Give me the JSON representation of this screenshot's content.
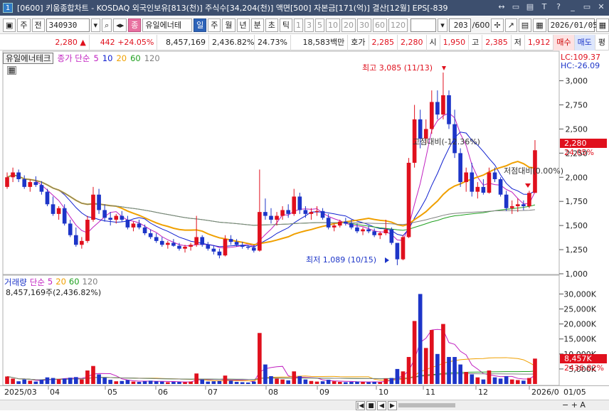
{
  "window": {
    "app_icon": "1",
    "title": "[0600] 키움종합차트 - KOSDAQ 외국인보유[813(천)] 주식수[34,204(천)] 액면[500] 자본금[171(억)] 결산[12월] EPS[-839",
    "buttons": [
      "↔",
      "▭",
      "▤",
      "T",
      "?",
      "_",
      "▭",
      "✕"
    ]
  },
  "toolbar": {
    "market": "주",
    "prev": "전",
    "code": "340930",
    "stock_name": "유일에너테",
    "period_selected": "일",
    "periods": [
      "일",
      "주",
      "월",
      "년",
      "분",
      "초",
      "틱"
    ],
    "intervals": [
      "1",
      "3",
      "5",
      "10",
      "20",
      "30",
      "60",
      "120"
    ],
    "count": "203",
    "count_max": "/600",
    "date": "2026/01/05"
  },
  "quote": {
    "price": "2,280",
    "arrow": "▲",
    "change": "442",
    "change_pct": "+24.05%",
    "volume": "8,457,169",
    "volume_ratio": "2,436.82%",
    "turnover": "24.73%",
    "amount": "18,583백만",
    "hoga_label": "호가",
    "hoga_ask": "2,285",
    "hoga_bid": "2,280",
    "open_label": "시",
    "open": "1,950",
    "high_label": "고",
    "high": "2,385",
    "low_label": "저",
    "low": "1,912",
    "buy": "매수",
    "sell": "매도",
    "eval": "평"
  },
  "price_legend": {
    "stock": "유일에너테크",
    "ma_label": "종가 단순",
    "ma": [
      "5",
      "10",
      "20",
      "60",
      "120"
    ],
    "ma_colors": [
      "#c020c0",
      "#1020d0",
      "#f0a000",
      "#20a020",
      "#808080"
    ],
    "lc": "LC:109.37",
    "hc": "HC:-26.09"
  },
  "volume_legend": {
    "label": "거래량",
    "ma_label": "단순",
    "ma": [
      "5",
      "20",
      "60",
      "120"
    ],
    "value": "8,457,169주(2,436.82%)"
  },
  "annotations": {
    "high": "최고 3,085 (11/13)",
    "low": "최저 1,089 (10/15)",
    "a1": "-26.09%",
    "a1_prefix": "고점대비(-12.36%)",
    "a2": "저점대비(0.00%)"
  },
  "price_axis": [
    "3,000",
    "2,750",
    "2,500",
    "2,250",
    "2,000",
    "1,750",
    "1,500",
    "1,250",
    "1,000"
  ],
  "volume_axis": [
    "30,000K",
    "25,000K",
    "20,000K",
    "15,000K",
    "10,000K",
    "5,000K"
  ],
  "price_tags": {
    "close": "2,280",
    "pct": "24.05%",
    "vol": "8,457K",
    "vol_pct": "2436.82%"
  },
  "x_labels": [
    "2025/03",
    "04",
    "05",
    "06",
    "07",
    "08",
    "09",
    "10",
    "11",
    "12",
    "2026/0",
    "01/05"
  ],
  "chart_data": {
    "type": "candlestick",
    "ylim": [
      1000,
      3100
    ],
    "vol_ylim": [
      0,
      32000
    ],
    "daily": [
      [
        1900,
        2050,
        1880,
        2000,
        2500
      ],
      [
        2000,
        2100,
        1950,
        2050,
        1800
      ],
      [
        2050,
        2080,
        1950,
        1980,
        900
      ],
      [
        1980,
        2020,
        1880,
        1900,
        1500
      ],
      [
        1900,
        1980,
        1850,
        1950,
        1100
      ],
      [
        1950,
        2010,
        1900,
        1920,
        800
      ],
      [
        1920,
        1960,
        1820,
        1850,
        1400
      ],
      [
        1850,
        1880,
        1700,
        1720,
        2200
      ],
      [
        1720,
        1800,
        1600,
        1620,
        2000
      ],
      [
        1620,
        1700,
        1560,
        1680,
        1600
      ],
      [
        1680,
        1720,
        1500,
        1520,
        1800
      ],
      [
        1520,
        1560,
        1380,
        1400,
        2100
      ],
      [
        1400,
        1480,
        1280,
        1300,
        2300
      ],
      [
        1300,
        1380,
        1260,
        1340,
        1500
      ],
      [
        1340,
        1600,
        1320,
        1560,
        4500
      ],
      [
        1560,
        1900,
        1540,
        1820,
        6000
      ],
      [
        1820,
        1880,
        1620,
        1660,
        3200
      ],
      [
        1660,
        1720,
        1540,
        1580,
        2100
      ],
      [
        1580,
        1640,
        1500,
        1560,
        1400
      ],
      [
        1560,
        1620,
        1520,
        1600,
        900
      ],
      [
        1600,
        1650,
        1540,
        1560,
        1000
      ],
      [
        1560,
        1600,
        1460,
        1480,
        1300
      ],
      [
        1480,
        1540,
        1440,
        1520,
        800
      ],
      [
        1520,
        1560,
        1460,
        1480,
        700
      ],
      [
        1480,
        1510,
        1400,
        1420,
        900
      ],
      [
        1420,
        1460,
        1360,
        1380,
        1100
      ],
      [
        1380,
        1420,
        1320,
        1340,
        900
      ],
      [
        1340,
        1380,
        1280,
        1300,
        800
      ],
      [
        1300,
        1340,
        1260,
        1320,
        600
      ],
      [
        1320,
        1360,
        1280,
        1290,
        700
      ],
      [
        1290,
        1320,
        1240,
        1260,
        700
      ],
      [
        1260,
        1300,
        1220,
        1280,
        600
      ],
      [
        1280,
        1320,
        1240,
        1300,
        800
      ],
      [
        1300,
        1600,
        1280,
        1380,
        3500
      ],
      [
        1380,
        1400,
        1280,
        1300,
        1500
      ],
      [
        1300,
        1330,
        1240,
        1260,
        800
      ],
      [
        1260,
        1290,
        1200,
        1230,
        900
      ],
      [
        1230,
        1260,
        1160,
        1190,
        1000
      ],
      [
        1190,
        1400,
        1180,
        1360,
        2800
      ],
      [
        1360,
        1400,
        1300,
        1330,
        1100
      ],
      [
        1330,
        1360,
        1280,
        1300,
        700
      ],
      [
        1300,
        1330,
        1260,
        1280,
        600
      ],
      [
        1280,
        1300,
        1250,
        1270,
        500
      ],
      [
        1270,
        1300,
        1220,
        1240,
        800
      ],
      [
        1240,
        2080,
        1230,
        1640,
        17000
      ],
      [
        1640,
        1780,
        1560,
        1600,
        6500
      ],
      [
        1600,
        1680,
        1520,
        1560,
        2600
      ],
      [
        1560,
        1640,
        1500,
        1600,
        1800
      ],
      [
        1600,
        1700,
        1560,
        1660,
        1500
      ],
      [
        1660,
        1720,
        1580,
        1620,
        1200
      ],
      [
        1620,
        1880,
        1600,
        1800,
        4200
      ],
      [
        1800,
        1840,
        1620,
        1660,
        2600
      ],
      [
        1660,
        1700,
        1580,
        1620,
        1500
      ],
      [
        1620,
        1680,
        1560,
        1640,
        1000
      ],
      [
        1640,
        1700,
        1600,
        1650,
        800
      ],
      [
        1650,
        1680,
        1560,
        1580,
        900
      ],
      [
        1580,
        1620,
        1460,
        1480,
        1400
      ],
      [
        1480,
        1520,
        1440,
        1500,
        900
      ],
      [
        1500,
        1560,
        1480,
        1540,
        700
      ],
      [
        1540,
        1580,
        1500,
        1520,
        600
      ],
      [
        1520,
        1560,
        1460,
        1480,
        700
      ],
      [
        1480,
        1520,
        1420,
        1440,
        800
      ],
      [
        1440,
        1480,
        1400,
        1460,
        700
      ],
      [
        1460,
        1500,
        1420,
        1440,
        600
      ],
      [
        1440,
        1470,
        1380,
        1400,
        700
      ],
      [
        1400,
        1440,
        1360,
        1420,
        600
      ],
      [
        1420,
        1560,
        1400,
        1460,
        1800
      ],
      [
        1460,
        1480,
        1300,
        1320,
        2000
      ],
      [
        1320,
        1200,
        1089,
        1150,
        5000
      ],
      [
        1150,
        1400,
        1140,
        1380,
        4200
      ],
      [
        1380,
        2200,
        1370,
        2150,
        9000
      ],
      [
        2150,
        2750,
        2100,
        2600,
        21000
      ],
      [
        2600,
        2700,
        2300,
        2400,
        30000
      ],
      [
        2400,
        2600,
        2350,
        2500,
        12000
      ],
      [
        2500,
        2900,
        2450,
        2780,
        18000
      ],
      [
        2780,
        2900,
        2600,
        2650,
        10000
      ],
      [
        2650,
        3085,
        2600,
        2850,
        20000
      ],
      [
        2850,
        2900,
        2500,
        2550,
        9000
      ],
      [
        2550,
        2700,
        2200,
        2250,
        9000
      ],
      [
        2250,
        2300,
        1900,
        1950,
        6500
      ],
      [
        1950,
        2100,
        1850,
        2050,
        4000
      ],
      [
        2050,
        2150,
        1800,
        1850,
        3200
      ],
      [
        1850,
        1950,
        1780,
        1900,
        2200
      ],
      [
        1900,
        1980,
        1820,
        1840,
        1500
      ],
      [
        1840,
        2100,
        1830,
        2050,
        4500
      ],
      [
        2050,
        2100,
        1950,
        1980,
        2200
      ],
      [
        1980,
        2000,
        1800,
        1820,
        1800
      ],
      [
        1820,
        1860,
        1650,
        1680,
        2600
      ],
      [
        1680,
        1760,
        1620,
        1700,
        1500
      ],
      [
        1700,
        1780,
        1640,
        1720,
        1300
      ],
      [
        1720,
        1760,
        1660,
        1700,
        1100
      ],
      [
        1700,
        1860,
        1680,
        1838,
        2000
      ],
      [
        1838,
        2385,
        1912,
        2280,
        8457
      ]
    ]
  }
}
